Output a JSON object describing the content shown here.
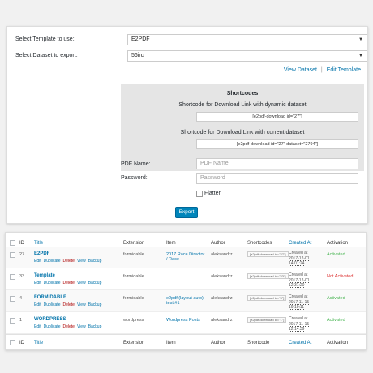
{
  "form": {
    "template_label": "Select Template to use:",
    "template_value": "E2PDF",
    "dataset_label": "Select Dataset to export:",
    "dataset_value": "56irc",
    "view_dataset": "View Dataset",
    "separator": "|",
    "edit_template": "Edit Template",
    "shortcodes_title": "Shortcodes",
    "dynamic_label": "Shortcode for Download Link with dynamic dataset",
    "dynamic_value": "[e2pdf-download id=\"27\"]",
    "current_label": "Shortcode for Download Link with current dataset",
    "current_value": "[e2pdf-download id=\"27\" dataset=\"2794\"]",
    "pdf_name_label": "PDF Name:",
    "pdf_name_placeholder": "PDF Name",
    "password_label": "Password:",
    "password_placeholder": "Password",
    "flatten_label": "Flatten",
    "export_button": "Export"
  },
  "table": {
    "columns": {
      "id": "ID",
      "title": "Title",
      "extension": "Extension",
      "item": "Item",
      "author": "Author",
      "shortcodes": "Shortcodes",
      "created": "Created At",
      "activation": "Activation"
    },
    "footer_columns": {
      "id": "ID",
      "title": "Title",
      "extension": "Extension",
      "item": "Item",
      "author": "Author",
      "shortcode": "Shortcode",
      "created": "Created At",
      "activation": "Activation"
    },
    "actions": {
      "edit": "Edit",
      "duplicate": "Duplicate",
      "delete": "Delete",
      "view": "View",
      "backup": "Backup"
    },
    "rows": [
      {
        "id": "27",
        "title": "E2PDF",
        "extension": "formidable",
        "item": "2017 Race Director / Race",
        "author": "aleksandrz",
        "shortcode": "[e2pdf-download id=\"27\"]",
        "created_line1": "Created at",
        "created_date": "2017-12-01",
        "created_time": "14:01:24",
        "activation": "Activated",
        "active": true
      },
      {
        "id": "33",
        "title": "Template",
        "extension": "formidable",
        "item": "",
        "author": "aleksandrz",
        "shortcode": "[e2pdf-download id=\"33\"]",
        "created_line1": "Created at",
        "created_date": "2017-12-01",
        "created_time": "12:31:20",
        "activation": "Not Activated",
        "active": false
      },
      {
        "id": "4",
        "title": "FORMIDABLE",
        "extension": "formidable",
        "item": "e2pdf (layout auto) test #1",
        "author": "aleksandrz",
        "shortcode": "[e2pdf-download id=\"4\"]",
        "created_line1": "Created at",
        "created_date": "2017-11-15",
        "created_time": "19:19:11",
        "activation": "Activated",
        "active": true
      },
      {
        "id": "1",
        "title": "WORDPRESS",
        "extension": "wordpress",
        "item": "Wordpress Posts",
        "author": "aleksandrz",
        "shortcode": "[e2pdf-download id=\"1\"]",
        "created_line1": "Created at",
        "created_date": "2017-11-15",
        "created_time": "12:14:39",
        "activation": "Activated",
        "active": true
      }
    ]
  }
}
